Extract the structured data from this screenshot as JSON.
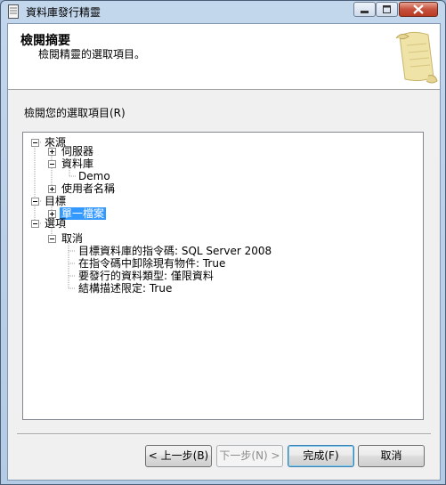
{
  "window": {
    "title": "資料庫發行精靈",
    "icon": "database-document-icon"
  },
  "header": {
    "title": "檢閱摘要",
    "subtitle": "檢閱精靈的選取項目。",
    "image": "scroll-icon"
  },
  "selection_label": "檢閱您的選取項目(R)",
  "tree": {
    "source": "來源",
    "server": "伺服器",
    "database": "資料庫",
    "database_name": "Demo",
    "username": "使用者名稱",
    "target": "目標",
    "single_file": "單一檔案",
    "options": "選項",
    "cancel": "取消",
    "opt_1": "目標資料庫的指令碼: SQL Server 2008",
    "opt_2": "在指令碼中卸除現有物件: True",
    "opt_3": "要發行的資料類型: 僅限資料",
    "opt_4": "結構描述限定: True"
  },
  "buttons": {
    "back": "< 上一步(B)",
    "next": "下一步(N) >",
    "finish": "完成(F)",
    "cancel": "取消"
  },
  "colors": {
    "selection": "#3399ff",
    "close_button": "#c7513d"
  }
}
